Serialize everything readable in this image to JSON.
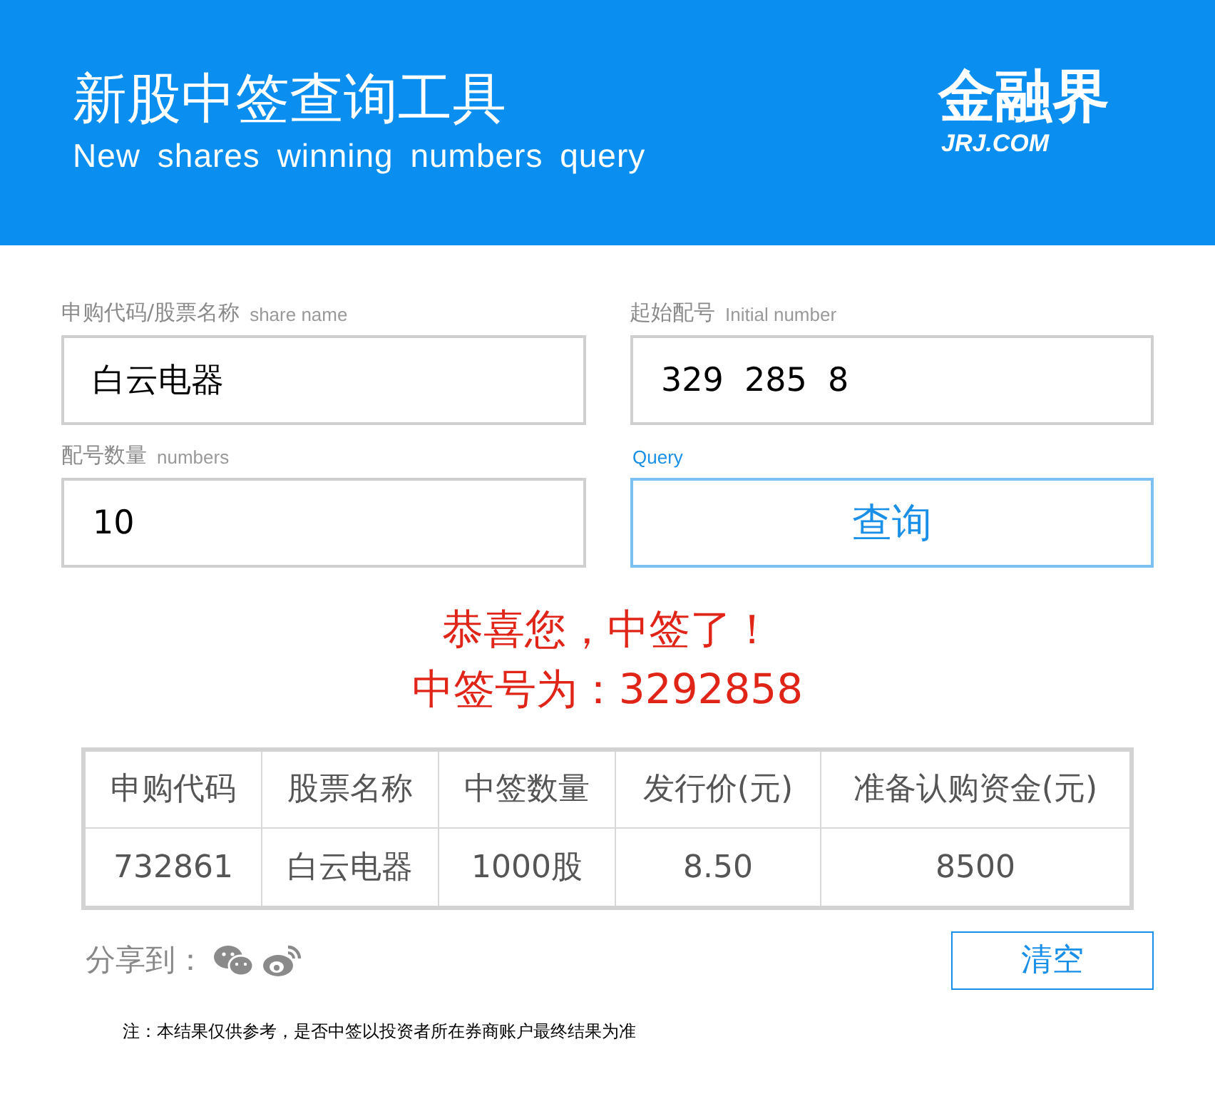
{
  "header": {
    "title": "新股中签查询工具",
    "subtitle": "New shares winning numbers query",
    "logo": {
      "name": "金融界",
      "domain": "JRJ.COM"
    }
  },
  "form": {
    "fields": [
      {
        "label": "申购代码/股票名称",
        "hint": "share name",
        "value": "白云电器"
      },
      {
        "label": "起始配号",
        "hint": "Initial number",
        "value": "329  285  8"
      },
      {
        "label": "配号数量",
        "hint": "numbers",
        "value": "10"
      }
    ],
    "query": {
      "hint": "Query",
      "label": "查询"
    }
  },
  "result": {
    "lines": [
      "恭喜您，中签了！",
      "中签号为：3292858"
    ]
  },
  "table": {
    "columns": [
      "申购代码",
      "股票名称",
      "中签数量",
      "发行价(元)",
      "准备认购资金(元)"
    ],
    "rows": [
      [
        "732861",
        "白云电器",
        "1000股",
        "8.50",
        "8500"
      ]
    ]
  },
  "share": {
    "label": "分享到："
  },
  "clear_button": "清空",
  "note": "注：本结果仅供参考，是否中签以投资者所在券商账户最终结果为准"
}
